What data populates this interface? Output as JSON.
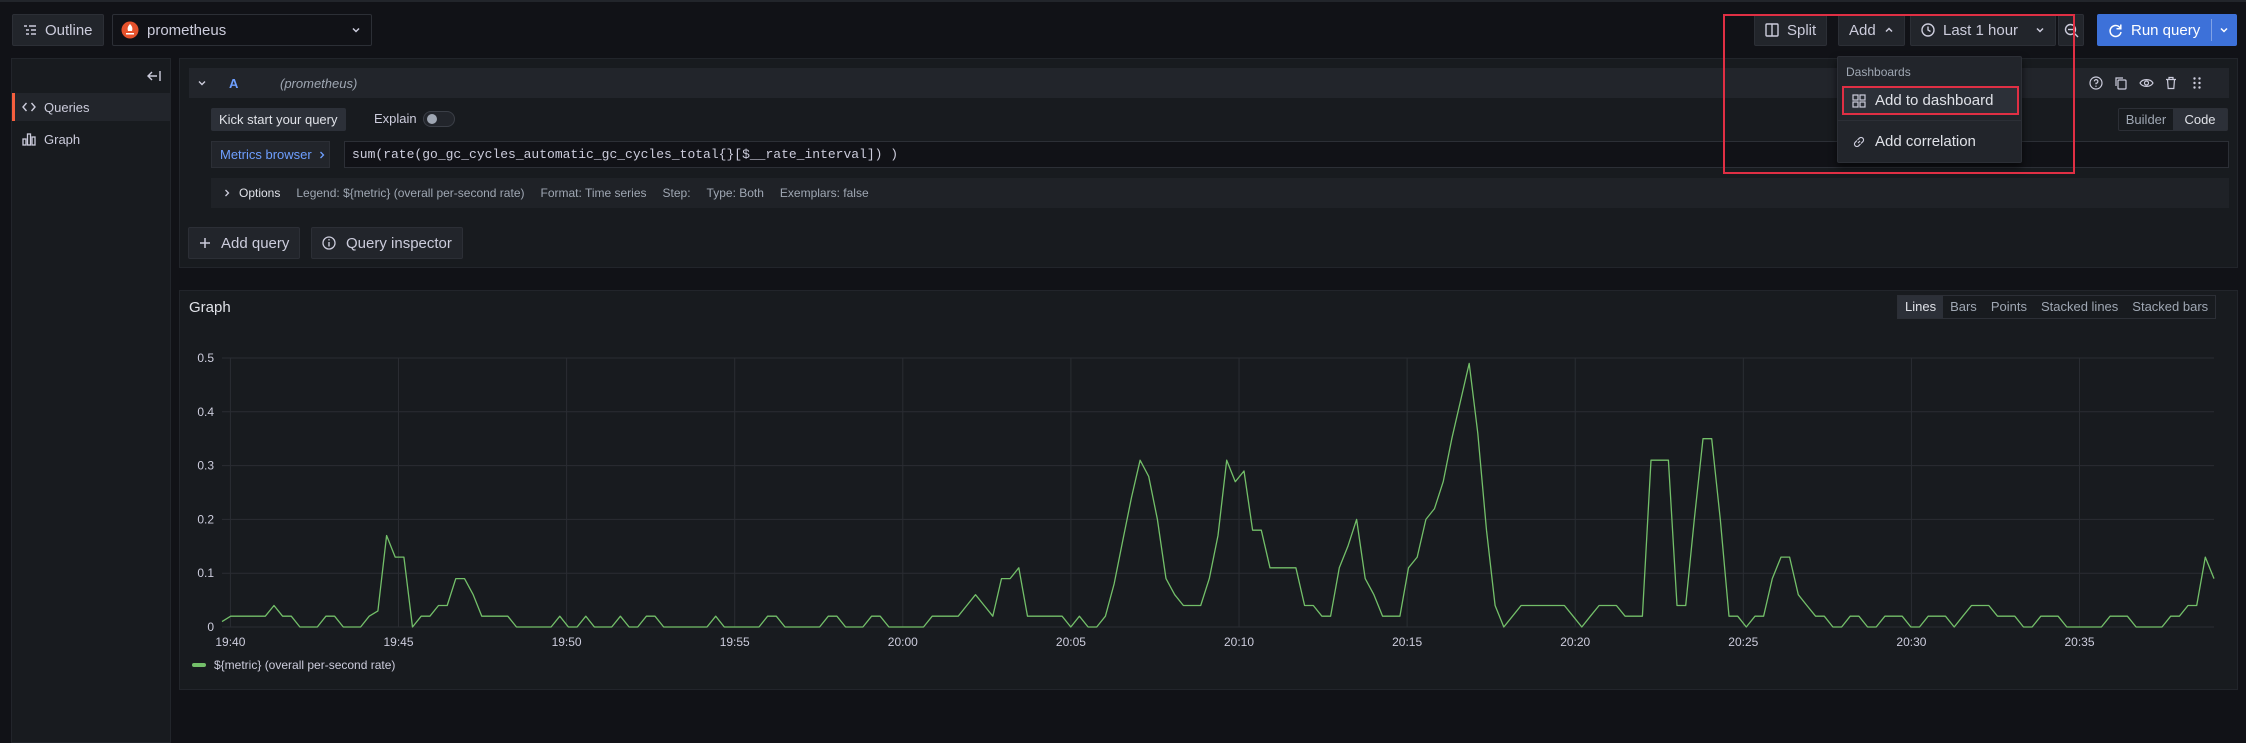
{
  "toolbar": {
    "outline_label": "Outline",
    "datasource": "prometheus",
    "split_label": "Split",
    "add_label": "Add",
    "time_range": "Last 1 hour",
    "run_query_label": "Run query"
  },
  "add_menu": {
    "section": "Dashboards",
    "items": [
      "Add to dashboard",
      "Add correlation"
    ]
  },
  "sidebar": {
    "items": [
      {
        "label": "Queries",
        "icon": "code-icon",
        "active": true
      },
      {
        "label": "Graph",
        "icon": "bar-chart-icon",
        "active": false
      }
    ]
  },
  "query": {
    "ref_id": "A",
    "datasource_hint": "(prometheus)",
    "kick_start": "Kick start your query",
    "explain": "Explain",
    "mode_builder": "Builder",
    "mode_code": "Code",
    "metrics_browser": "Metrics browser",
    "expression": "sum(rate(go_gc_cycles_automatic_gc_cycles_total{}[$__rate_interval]) )",
    "options_label": "Options",
    "options_summary": [
      "Legend: ${metric} (overall per-second rate)",
      "Format: Time series",
      "Step:",
      "Type: Both",
      "Exemplars: false"
    ]
  },
  "actions": {
    "add_query": "Add query",
    "query_inspector": "Query inspector"
  },
  "graph": {
    "title": "Graph",
    "display_modes": [
      "Lines",
      "Bars",
      "Points",
      "Stacked lines",
      "Stacked bars"
    ],
    "active_mode": "Lines",
    "legend": "${metric} (overall per-second rate)",
    "series_color": "#73bf69"
  },
  "chart_data": {
    "type": "line",
    "ylim": [
      0,
      0.5
    ],
    "yticks": [
      "0",
      "0.1",
      "0.2",
      "0.3",
      "0.4",
      "0.5"
    ],
    "xticks": [
      "19:40",
      "19:45",
      "19:50",
      "19:55",
      "20:00",
      "20:05",
      "20:10",
      "20:15",
      "20:20",
      "20:25",
      "20:30",
      "20:35"
    ],
    "x_start": "19:39:45",
    "x_end": "20:39:00",
    "series": [
      {
        "name": "${metric} (overall per-second rate)",
        "values": [
          0.01,
          0.02,
          0.02,
          0.02,
          0.02,
          0.02,
          0.04,
          0.02,
          0.02,
          0,
          0,
          0,
          0.02,
          0.02,
          0,
          0,
          0,
          0.02,
          0.03,
          0.17,
          0.13,
          0.13,
          0,
          0.02,
          0.02,
          0.04,
          0.04,
          0.09,
          0.09,
          0.06,
          0.02,
          0.02,
          0.02,
          0.02,
          0,
          0,
          0,
          0,
          0,
          0.02,
          0,
          0,
          0.02,
          0,
          0,
          0,
          0.02,
          0,
          0,
          0.02,
          0.02,
          0,
          0,
          0,
          0,
          0,
          0,
          0.02,
          0,
          0,
          0,
          0,
          0,
          0.02,
          0.02,
          0,
          0,
          0,
          0,
          0,
          0.02,
          0.02,
          0,
          0,
          0,
          0.02,
          0.02,
          0,
          0,
          0,
          0,
          0,
          0.02,
          0.02,
          0.02,
          0.02,
          0.04,
          0.06,
          0.04,
          0.02,
          0.09,
          0.09,
          0.11,
          0.02,
          0.02,
          0.02,
          0.02,
          0.02,
          0,
          0.02,
          0,
          0,
          0.02,
          0.08,
          0.16,
          0.24,
          0.31,
          0.28,
          0.2,
          0.09,
          0.06,
          0.04,
          0.04,
          0.04,
          0.09,
          0.17,
          0.31,
          0.27,
          0.29,
          0.18,
          0.18,
          0.11,
          0.11,
          0.11,
          0.11,
          0.04,
          0.04,
          0.02,
          0.02,
          0.11,
          0.15,
          0.2,
          0.09,
          0.06,
          0.02,
          0.02,
          0.02,
          0.11,
          0.13,
          0.2,
          0.22,
          0.27,
          0.35,
          0.42,
          0.49,
          0.36,
          0.18,
          0.04,
          0,
          0.02,
          0.04,
          0.04,
          0.04,
          0.04,
          0.04,
          0.04,
          0.02,
          0,
          0.02,
          0.04,
          0.04,
          0.04,
          0.02,
          0.02,
          0.02,
          0.31,
          0.31,
          0.31,
          0.04,
          0.04,
          0.2,
          0.35,
          0.35,
          0.2,
          0.02,
          0.02,
          0,
          0.02,
          0.02,
          0.09,
          0.13,
          0.13,
          0.06,
          0.04,
          0.02,
          0.02,
          0,
          0,
          0.02,
          0.02,
          0,
          0,
          0.02,
          0.02,
          0.02,
          0,
          0,
          0.02,
          0.02,
          0.02,
          0,
          0.02,
          0.04,
          0.04,
          0.04,
          0.02,
          0.02,
          0.02,
          0,
          0,
          0.02,
          0.02,
          0.02,
          0,
          0,
          0,
          0,
          0,
          0.02,
          0.02,
          0.02,
          0,
          0,
          0,
          0,
          0.02,
          0.02,
          0.04,
          0.04,
          0.13,
          0.09
        ]
      }
    ]
  }
}
